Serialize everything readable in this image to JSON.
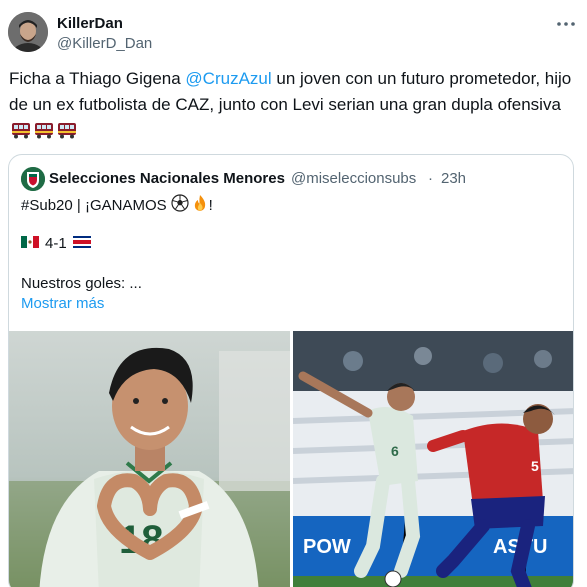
{
  "author": {
    "display_name": "KillerDan",
    "handle": "@KillerD_Dan"
  },
  "tweet": {
    "text_before": "Ficha a Thiago Gigena ",
    "mention": "@CruzAzul",
    "text_after": "  un joven con un futuro prometedor, hijo de un ex futbolista de CAZ, junto con Levi serian una gran dupla ofensiva",
    "emoji": "railway-car x3"
  },
  "quote": {
    "display_name": "Selecciones Nacionales Menores",
    "handle": "@miseleccionsubs",
    "separator": "·",
    "time": "23h",
    "line1": "#Sub20 | ¡GANAMOS",
    "line1_end": "!",
    "score": "4-1",
    "line3": "Nuestros goles:  ...",
    "show_more": "Mostrar más"
  },
  "colors": {
    "link": "#1d9bf0",
    "text": "#0f1419",
    "secondary": "#536471",
    "border": "#cfd9de"
  }
}
